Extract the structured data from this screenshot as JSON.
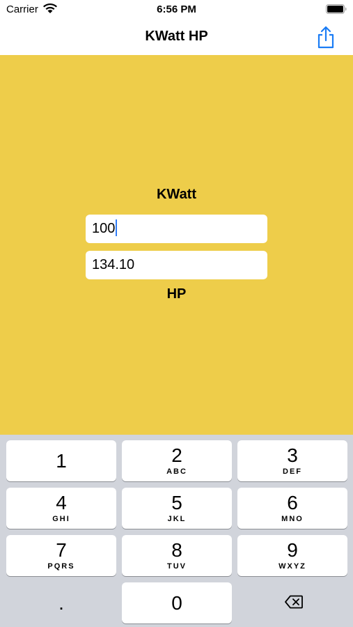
{
  "status_bar": {
    "carrier": "Carrier",
    "time": "6:56 PM"
  },
  "nav": {
    "title": "KWatt HP",
    "share_icon": "share-icon"
  },
  "converter": {
    "kwatt_label": "KWatt",
    "kwatt_value": "100",
    "hp_value": "134.10",
    "hp_label": "HP",
    "background_color": "#eecd4a"
  },
  "keyboard": {
    "keys": [
      {
        "digit": "1",
        "letters": ""
      },
      {
        "digit": "2",
        "letters": "ABC"
      },
      {
        "digit": "3",
        "letters": "DEF"
      },
      {
        "digit": "4",
        "letters": "GHI"
      },
      {
        "digit": "5",
        "letters": "JKL"
      },
      {
        "digit": "6",
        "letters": "MNO"
      },
      {
        "digit": "7",
        "letters": "PQRS"
      },
      {
        "digit": "8",
        "letters": "TUV"
      },
      {
        "digit": "9",
        "letters": "WXYZ"
      },
      {
        "digit": "0",
        "letters": ""
      }
    ],
    "decimal": ".",
    "delete_icon": "backspace-icon"
  }
}
